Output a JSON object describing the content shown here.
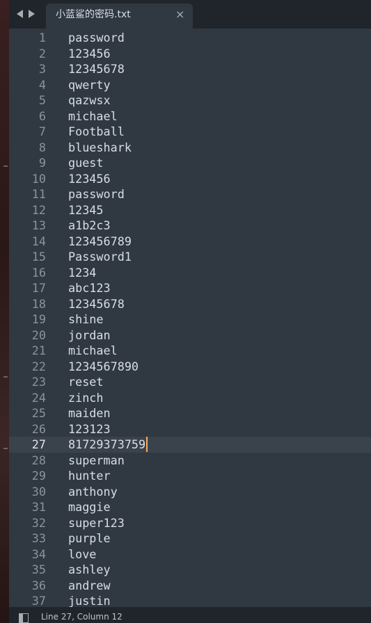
{
  "tab": {
    "title": "小蓝鲨的密码.txt",
    "close_glyph": "×"
  },
  "editor": {
    "current_line": 27,
    "lines": [
      "password",
      "123456",
      "12345678",
      "qwerty",
      "qazwsx",
      "michael",
      "Football",
      "blueshark",
      "guest",
      "123456",
      "password",
      "12345",
      "a1b2c3",
      "123456789",
      "Password1",
      "1234",
      "abc123",
      "12345678",
      "shine",
      "jordan",
      "michael",
      "1234567890",
      "reset",
      "zinch",
      "maiden",
      "123123",
      "81729373759",
      "superman",
      "hunter",
      "anthony",
      "maggie",
      "super123",
      "purple",
      "love",
      "ashley",
      "andrew",
      "justin"
    ]
  },
  "status": {
    "position": "Line 27, Column 12"
  },
  "colors": {
    "caret": "#f9ae58",
    "editor_bg": "#303841",
    "chrome_bg": "#1f252b"
  }
}
